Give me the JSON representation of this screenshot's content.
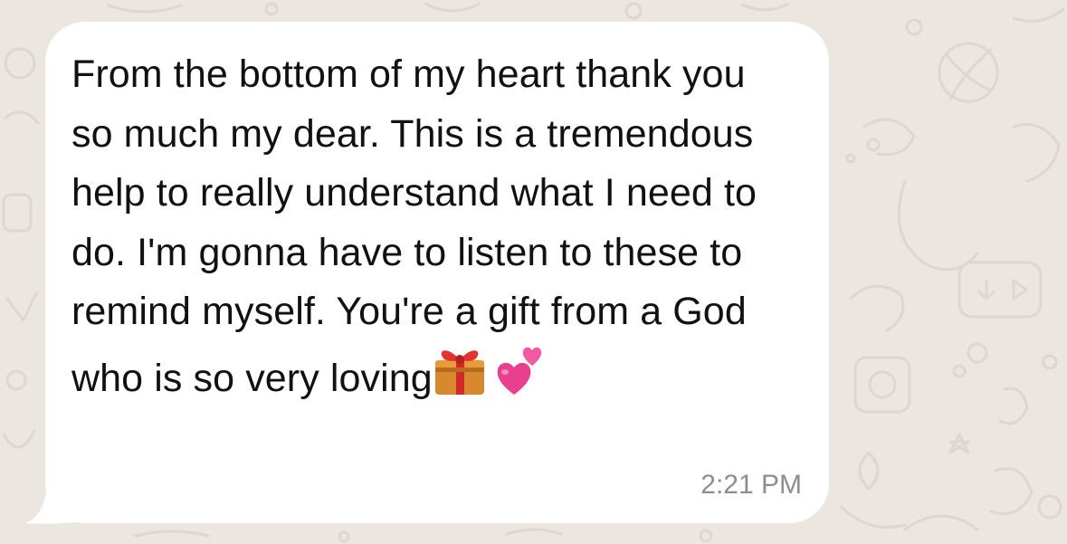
{
  "message": {
    "text": "From the bottom of my heart thank you so much my dear. This is a tremendous help to really understand what I need to do. I'm gonna have to listen to these to remind myself. You're a gift from a God who is so very loving",
    "emojis": [
      "wrapped-gift",
      "two-hearts"
    ],
    "timestamp": "2:21 PM"
  },
  "colors": {
    "wallpaper": "#ebe6df",
    "bubble": "#ffffff",
    "text": "#111111",
    "timestamp": "#8d8d92"
  }
}
